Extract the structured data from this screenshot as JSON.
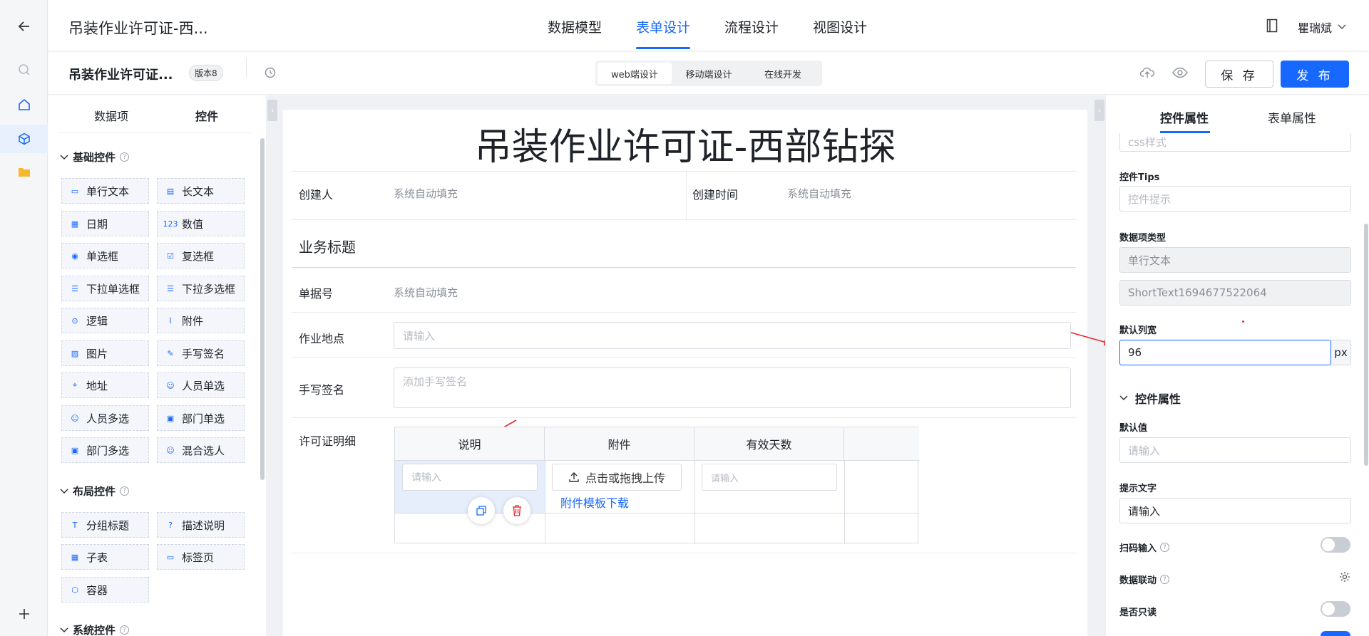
{
  "app": {
    "title": "吊装作业许可证-西...",
    "user": "瞿瑞斌",
    "tabs": [
      {
        "label": "数据模型"
      },
      {
        "label": "表单设计"
      },
      {
        "label": "流程设计"
      },
      {
        "label": "视图设计"
      }
    ],
    "active_tab": "表单设计"
  },
  "subbar": {
    "form_name": "吊装作业许可证...",
    "version": "版本8",
    "modes": [
      "web端设计",
      "移动端设计",
      "在线开发"
    ],
    "active_mode": "web端设计",
    "save_label": "保 存",
    "publish_label": "发 布"
  },
  "left_panel": {
    "tabs": [
      "数据项",
      "控件"
    ],
    "active_tab": "控件",
    "groups": [
      {
        "title": "基础控件",
        "items": [
          "单行文本",
          "长文本",
          "日期",
          "数值",
          "单选框",
          "复选框",
          "下拉单选框",
          "下拉多选框",
          "逻辑",
          "附件",
          "图片",
          "手写签名",
          "地址",
          "人员单选",
          "人员多选",
          "部门单选",
          "部门多选",
          "混合选人"
        ]
      },
      {
        "title": "布局控件",
        "items": [
          "分组标题",
          "描述说明",
          "子表",
          "标签页",
          "容器"
        ]
      },
      {
        "title": "系统控件",
        "items": []
      }
    ]
  },
  "form": {
    "title": "吊装作业许可证-西部钻探",
    "creator_label": "创建人",
    "creator_value": "系统自动填充",
    "created_time_label": "创建时间",
    "created_time_value": "系统自动填充",
    "section_title": "业务标题",
    "doc_no_label": "单据号",
    "doc_no_value": "系统自动填充",
    "location_label": "作业地点",
    "location_placeholder": "请输入",
    "signature_label": "手写签名",
    "signature_placeholder": "添加手写签名",
    "detail_label": "许可证明细",
    "subtable": {
      "columns": [
        "说明",
        "附件",
        "有效天数"
      ],
      "row_input_placeholder": "请输入",
      "upload_label": "点击或拖拽上传",
      "template_link": "附件模板下载",
      "days_placeholder": "请输入"
    }
  },
  "right_panel": {
    "tabs": [
      "控件属性",
      "表单属性"
    ],
    "active_tab": "控件属性",
    "css_placeholder": "css样式",
    "tips_label": "控件Tips",
    "tips_placeholder": "控件提示",
    "data_type_label": "数据项类型",
    "data_type_value": "单行文本",
    "field_code": "ShortText1694677522064",
    "col_width_label": "默认列宽",
    "col_width_value": "96",
    "col_width_unit": "px",
    "ctrl_props_title": "控件属性",
    "default_label": "默认值",
    "default_placeholder": "请输入",
    "hint_label": "提示文字",
    "hint_value": "请输入",
    "scan_label": "扫码输入",
    "link_label": "数据联动",
    "readonly_label": "是否只读"
  },
  "colors": {
    "accent": "#1768ff",
    "annotation_arrow": "#e8262b"
  }
}
